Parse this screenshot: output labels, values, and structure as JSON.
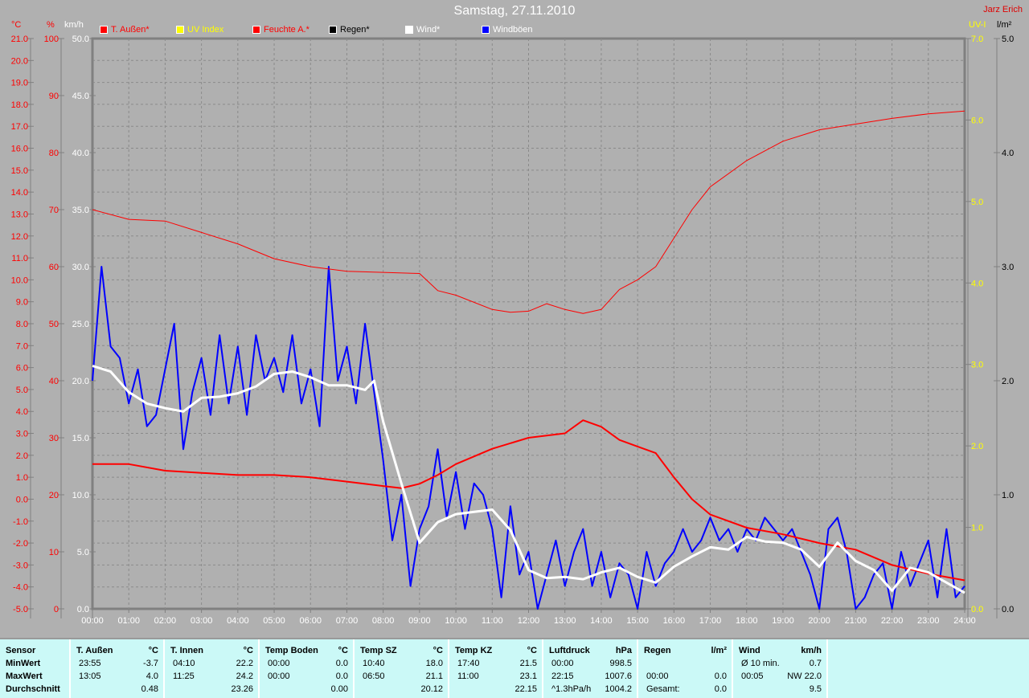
{
  "header": {
    "title": "Samstag, 27.11.2010",
    "author": "Jarz Erich"
  },
  "colors": {
    "t_aussen": "#ff0000",
    "uv": "#ffff00",
    "feuchte": "#ff0000",
    "regen": "#000000",
    "wind": "#ffffff",
    "windboeen": "#0000ff",
    "background": "#b0b0b0",
    "table_bg": "#cbf9f7"
  },
  "legend": [
    {
      "label": "T. Außen*",
      "color": "#ff0000",
      "text_color": "#ff0000"
    },
    {
      "label": "UV Index",
      "color": "#ffff00",
      "text_color": "#ffff00"
    },
    {
      "label": "Feuchte A.*",
      "color": "#ff0000",
      "text_color": "#ff0000"
    },
    {
      "label": "Regen*",
      "color": "#000000",
      "text_color": "#000000"
    },
    {
      "label": "Wind*",
      "color": "#ffffff",
      "text_color": "#ffffff"
    },
    {
      "label": "Windböen",
      "color": "#0000ff",
      "text_color": "#ffffff"
    }
  ],
  "chart_data": {
    "type": "line",
    "title": "Samstag, 27.11.2010",
    "xlabel": "",
    "x_ticks": [
      "00:00",
      "01:00",
      "02:00",
      "03:00",
      "04:00",
      "05:00",
      "06:00",
      "07:00",
      "08:00",
      "09:00",
      "10:00",
      "11:00",
      "12:00",
      "13:00",
      "14:00",
      "15:00",
      "16:00",
      "17:00",
      "18:00",
      "19:00",
      "20:00",
      "21:00",
      "22:00",
      "23:00",
      "24:00"
    ],
    "xlim_hours": [
      0,
      24
    ],
    "grid": true,
    "legend_position": "top",
    "axes": {
      "temp": {
        "unit": "°C",
        "range": [
          -5,
          21
        ],
        "step": 1,
        "side": "left",
        "color": "#ff0000"
      },
      "humidity": {
        "unit": "%",
        "range": [
          0,
          100
        ],
        "step": 10,
        "side": "left",
        "color": "#ff0000"
      },
      "wind": {
        "unit": "km/h",
        "range": [
          0,
          50
        ],
        "step": 5,
        "side": "left",
        "color": "#ffffff"
      },
      "uv": {
        "unit": "UV-I",
        "range": [
          0,
          7
        ],
        "step": 1,
        "side": "right",
        "color": "#ffff00"
      },
      "rain": {
        "unit": "l/m²",
        "range": [
          0,
          5
        ],
        "step": 1,
        "side": "right",
        "color": "#000000"
      }
    },
    "series": [
      {
        "name": "T. Außen*",
        "axis": "temp",
        "color": "#ff0000",
        "width": 2,
        "points": [
          [
            0,
            1.6
          ],
          [
            1,
            1.6
          ],
          [
            2,
            1.3
          ],
          [
            3,
            1.2
          ],
          [
            4,
            1.1
          ],
          [
            5,
            1.1
          ],
          [
            6,
            1.0
          ],
          [
            7,
            0.8
          ],
          [
            8,
            0.6
          ],
          [
            8.5,
            0.5
          ],
          [
            9,
            0.7
          ],
          [
            9.5,
            1.1
          ],
          [
            10,
            1.6
          ],
          [
            11,
            2.3
          ],
          [
            12,
            2.8
          ],
          [
            12.5,
            2.9
          ],
          [
            13,
            3.0
          ],
          [
            13.5,
            3.6
          ],
          [
            14,
            3.3
          ],
          [
            14.5,
            2.7
          ],
          [
            15,
            2.4
          ],
          [
            15.5,
            2.1
          ],
          [
            16,
            1.0
          ],
          [
            16.5,
            0.0
          ],
          [
            17,
            -0.7
          ],
          [
            18,
            -1.3
          ],
          [
            19,
            -1.6
          ],
          [
            20,
            -2.0
          ],
          [
            21,
            -2.3
          ],
          [
            22,
            -3.0
          ],
          [
            23,
            -3.4
          ],
          [
            24,
            -3.7
          ]
        ]
      },
      {
        "name": "Feuchte A.*",
        "axis": "humidity",
        "color": "#ff0000",
        "width": 1,
        "points": [
          [
            0,
            70
          ],
          [
            1,
            68.3
          ],
          [
            2,
            68
          ],
          [
            3,
            66
          ],
          [
            4,
            64
          ],
          [
            5,
            61.4
          ],
          [
            6,
            60
          ],
          [
            7,
            59.2
          ],
          [
            8,
            59
          ],
          [
            9,
            58.8
          ],
          [
            9.5,
            55.8
          ],
          [
            10,
            55
          ],
          [
            11,
            52.5
          ],
          [
            11.5,
            52
          ],
          [
            12,
            52.2
          ],
          [
            12.5,
            53.5
          ],
          [
            13,
            52.5
          ],
          [
            13.5,
            51.8
          ],
          [
            14,
            52.5
          ],
          [
            14.5,
            56
          ],
          [
            15,
            57.7
          ],
          [
            15.5,
            60
          ],
          [
            16,
            65
          ],
          [
            16.5,
            70
          ],
          [
            17,
            74
          ],
          [
            18,
            78.6
          ],
          [
            19,
            82
          ],
          [
            20,
            84
          ],
          [
            21,
            85
          ],
          [
            22,
            86
          ],
          [
            23,
            86.8
          ],
          [
            24,
            87.3
          ]
        ]
      },
      {
        "name": "Wind*",
        "axis": "wind",
        "color": "#ffffff",
        "width": 3,
        "points": [
          [
            0,
            21.3
          ],
          [
            0.5,
            20.8
          ],
          [
            1,
            19
          ],
          [
            1.5,
            18
          ],
          [
            2,
            17.6
          ],
          [
            2.5,
            17.3
          ],
          [
            3,
            18.5
          ],
          [
            3.5,
            18.6
          ],
          [
            4,
            18.9
          ],
          [
            4.5,
            19.5
          ],
          [
            5,
            20.6
          ],
          [
            5.5,
            20.8
          ],
          [
            6,
            20.3
          ],
          [
            6.5,
            19.6
          ],
          [
            7,
            19.6
          ],
          [
            7.5,
            19.2
          ],
          [
            7.75,
            20
          ],
          [
            8,
            16.4
          ],
          [
            8.5,
            11
          ],
          [
            9,
            5.8
          ],
          [
            9.5,
            7.6
          ],
          [
            10,
            8.3
          ],
          [
            10.5,
            8.5
          ],
          [
            11,
            8.7
          ],
          [
            11.5,
            6.9
          ],
          [
            12,
            3.4
          ],
          [
            12.5,
            2.7
          ],
          [
            13,
            2.8
          ],
          [
            13.5,
            2.6
          ],
          [
            14,
            3.2
          ],
          [
            14.5,
            3.6
          ],
          [
            15,
            2.8
          ],
          [
            15.5,
            2.3
          ],
          [
            16,
            3.7
          ],
          [
            16.5,
            4.6
          ],
          [
            17,
            5.4
          ],
          [
            17.5,
            5.2
          ],
          [
            18,
            6.3
          ],
          [
            18.5,
            5.9
          ],
          [
            19,
            5.8
          ],
          [
            19.5,
            5.2
          ],
          [
            20,
            3.7
          ],
          [
            20.5,
            5.8
          ],
          [
            21,
            4.2
          ],
          [
            21.5,
            3.4
          ],
          [
            22,
            1.6
          ],
          [
            22.5,
            3.6
          ],
          [
            23,
            3.2
          ],
          [
            23.5,
            2.3
          ],
          [
            24,
            1.4
          ]
        ]
      },
      {
        "name": "Windböen",
        "axis": "wind",
        "color": "#0000ff",
        "width": 2,
        "interval_hours": 0.25,
        "values": [
          20,
          30,
          23,
          22,
          18,
          21,
          16,
          17,
          21,
          25,
          14,
          19,
          22,
          17,
          24,
          18,
          23,
          17,
          24,
          20,
          22,
          19,
          24,
          18,
          21,
          16,
          30,
          20,
          23,
          18,
          25,
          19,
          13,
          6,
          10,
          2,
          7,
          9,
          14,
          8,
          12,
          7,
          11,
          10,
          7,
          1,
          9,
          3,
          5,
          0,
          3,
          6,
          2,
          5,
          7,
          2,
          5,
          1,
          4,
          3,
          0,
          5,
          2,
          4,
          5,
          7,
          5,
          6,
          8,
          6,
          7,
          5,
          7,
          6,
          8,
          7,
          6,
          7,
          5,
          3,
          0,
          7,
          8,
          5,
          0,
          1,
          3,
          4,
          0,
          5,
          2,
          4,
          6,
          1,
          7,
          1,
          2
        ]
      }
    ]
  },
  "table": {
    "columns": [
      {
        "title": "Sensor",
        "unit": "",
        "rows": [
          [
            "MinWert",
            ""
          ],
          [
            "MaxWert",
            ""
          ],
          [
            "Durchschnitt",
            ""
          ]
        ],
        "bold_left": true
      },
      {
        "title": "T. Außen",
        "unit": "°C",
        "rows": [
          [
            "23:55",
            "-3.7"
          ],
          [
            "13:05",
            "4.0"
          ],
          [
            "",
            "0.48"
          ]
        ]
      },
      {
        "title": "T. Innen",
        "unit": "°C",
        "rows": [
          [
            "04:10",
            "22.2"
          ],
          [
            "11:25",
            "24.2"
          ],
          [
            "",
            "23.26"
          ]
        ]
      },
      {
        "title": "Temp Boden",
        "unit": "°C",
        "rows": [
          [
            "00:00",
            "0.0"
          ],
          [
            "00:00",
            "0.0"
          ],
          [
            "",
            "0.00"
          ]
        ]
      },
      {
        "title": "Temp SZ",
        "unit": "°C",
        "rows": [
          [
            "10:40",
            "18.0"
          ],
          [
            "06:50",
            "21.1"
          ],
          [
            "",
            "20.12"
          ]
        ]
      },
      {
        "title": "Temp KZ",
        "unit": "°C",
        "rows": [
          [
            "17:40",
            "21.5"
          ],
          [
            "11:00",
            "23.1"
          ],
          [
            "",
            "22.15"
          ]
        ]
      },
      {
        "title": "Luftdruck",
        "unit": "hPa",
        "rows": [
          [
            "00:00",
            "998.5"
          ],
          [
            "22:15",
            "1007.6"
          ],
          [
            "^1.3hPa/h",
            "1004.2"
          ]
        ]
      },
      {
        "title": "Regen",
        "unit": "l/m²",
        "rows": [
          [
            "",
            ""
          ],
          [
            "00:00",
            "0.0"
          ],
          [
            "Gesamt:",
            "0.0"
          ]
        ]
      },
      {
        "title": "Wind",
        "unit": "km/h",
        "rows": [
          [
            "Ø 10 min.",
            "0.7"
          ],
          [
            "00:05",
            "NW 22.0"
          ],
          [
            "",
            "9.5"
          ]
        ]
      }
    ]
  }
}
